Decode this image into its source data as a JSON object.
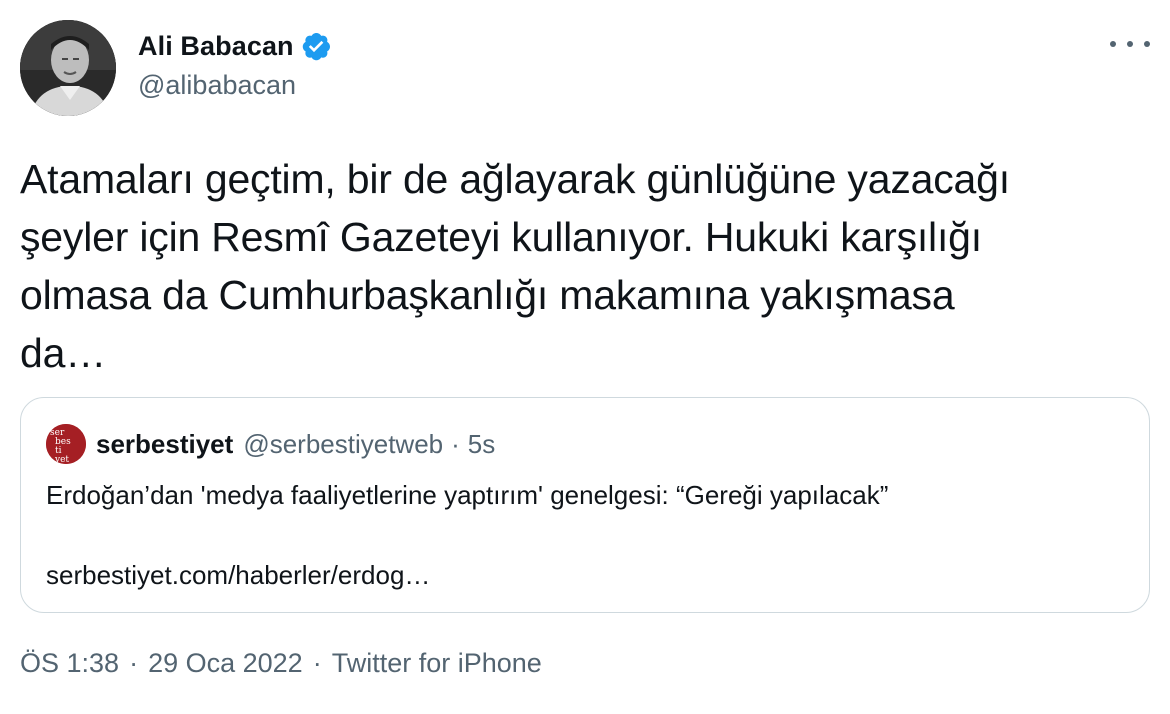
{
  "author": {
    "display_name": "Ali Babacan",
    "handle": "@alibabacan",
    "verified": true,
    "verified_color": "#1d9bf0"
  },
  "tweet": {
    "text": "Atamaları geçtim, bir de ağlayarak günlüğüne yazacağı\nşeyler için Resmî Gazeteyi kullanıyor. Hukuki karşılığı\nolmasa da Cumhurbaşkanlığı makamına yakışmasa\nda…"
  },
  "quote": {
    "display_name": "serbestiyet",
    "handle": "@serbestiyetweb",
    "separator": "·",
    "time": "5s",
    "text": "Erdoğan’dan 'medya faaliyetlerine yaptırım' genelgesi: “Gereği yapılacak”",
    "link": "serbestiyet.com/haberler/erdog…",
    "avatar_color": "#a51f24"
  },
  "footer": {
    "time": "ÖS 1:38",
    "separator": "·",
    "date": "29 Oca 2022",
    "source": "Twitter for iPhone"
  },
  "icons": {
    "more": "more-icon",
    "verified": "verified-badge-icon"
  }
}
